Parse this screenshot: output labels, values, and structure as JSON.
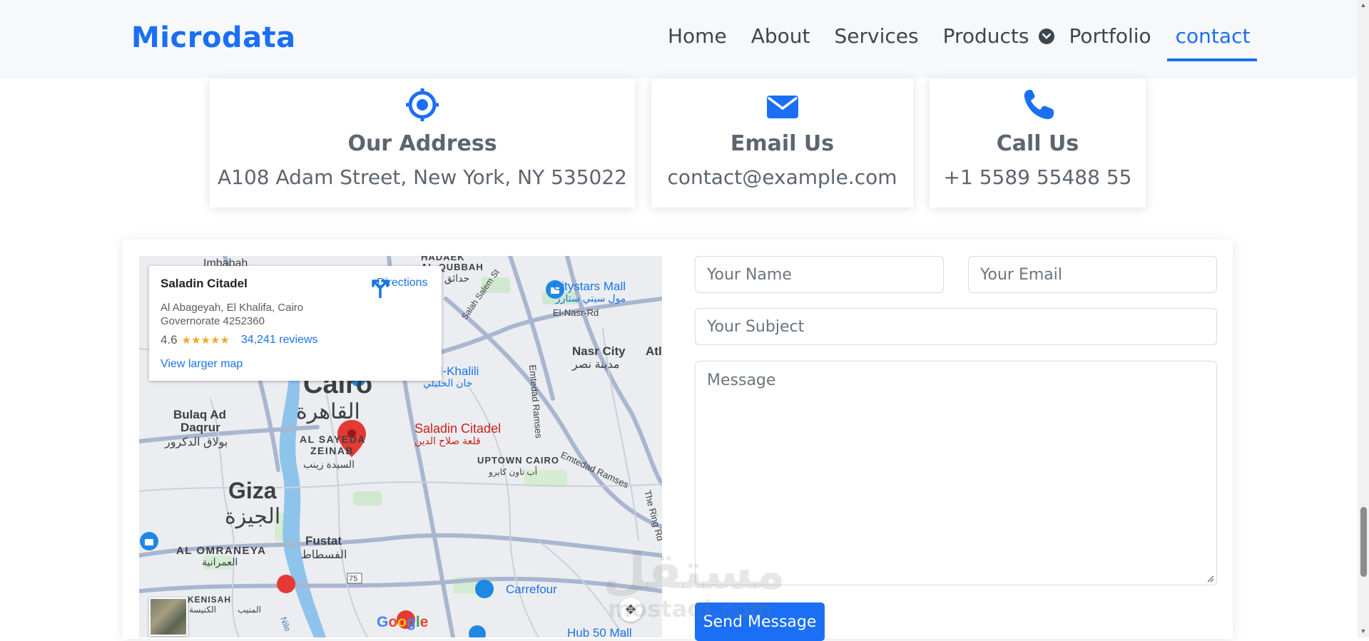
{
  "header": {
    "brand": "Microdata",
    "nav": [
      {
        "label": "Home"
      },
      {
        "label": "About"
      },
      {
        "label": "Services"
      },
      {
        "label": "Products"
      },
      {
        "label": "Portfolio"
      },
      {
        "label": "contact",
        "active": true
      }
    ]
  },
  "cards": [
    {
      "title": "Our Address",
      "value": "A108 Adam Street, New York, NY 535022",
      "icon": "location-crosshair-icon"
    },
    {
      "title": "Email Us",
      "value": "contact@example.com",
      "icon": "envelope-icon"
    },
    {
      "title": "Call Us",
      "value": "+1 5589 55488 55",
      "icon": "phone-icon"
    }
  ],
  "map": {
    "place_name": "Saladin Citadel",
    "address": "Al Abageyah, El Khalifa, Cairo Governorate 4252360",
    "rating": "4.6",
    "stars": "★★★★★",
    "reviews": "34,241 reviews",
    "directions": "Directions",
    "larger_map": "View larger map",
    "labels": {
      "imbabah": "Imbabah",
      "qubbah1": "HADAEK",
      "qubbah2": "AL-QUBBAH",
      "hadaek_ar": "حدائق الق",
      "citystars": "Citystars Mall",
      "citystars_ar": "مول سيتي ستارز",
      "elnasr": "El-Nasr-Rd",
      "salah": "Salah Salem St",
      "nasr_city": "Nasr City",
      "nasr_city_ar": "مدينة نصر",
      "atl": "Atl",
      "khalili": "n el-Khalili",
      "khalili_ar": "خان الخليلي",
      "cairo": "Cairo",
      "cairo_ar": "القاهرة",
      "bulaq1": "Bulaq Ad",
      "bulaq2": "Daqrur",
      "bulaq_ar": "بولاق الدكرور",
      "sayeda1": "AL SAYEDA",
      "sayeda2": "ZEINAB",
      "sayeda_ar": "السيدة زينب",
      "citadel": "Saladin Citadel",
      "citadel_ar": "قلعة صلاح الدين",
      "uptown": "UPTOWN CAIRO",
      "uptown_ar": "أب تاون كايرو",
      "emtedad": "Emtedad Ramses",
      "emtedad2": "Emtedad Ramses",
      "ringroad": "The Ring Rd",
      "giza": "Giza",
      "giza_ar": "الجيزة",
      "omraneya": "AL OMRANEYA",
      "omraneya_ar": "العمرانية",
      "fustat": "Fustat",
      "fustat_ar": "الفسطاط",
      "kenisah": "KENISAH",
      "kenisah_ar": "الكنيسة",
      "moneeb": "المنيب",
      "nile": "Nile",
      "road75": "75",
      "carrefour": "Carrefour",
      "hub50": "Hub 50 Mall",
      "google": "Google"
    }
  },
  "form": {
    "name_placeholder": "Your Name",
    "email_placeholder": "Your Email",
    "subject_placeholder": "Your Subject",
    "message_placeholder": "Message",
    "send_label": "Send Message"
  },
  "watermark": {
    "line1": "مستقل",
    "line2": "mostaql.com"
  },
  "colors": {
    "accent": "#1a6ff5",
    "text": "#5c6570",
    "map_link": "#1a73e8"
  }
}
